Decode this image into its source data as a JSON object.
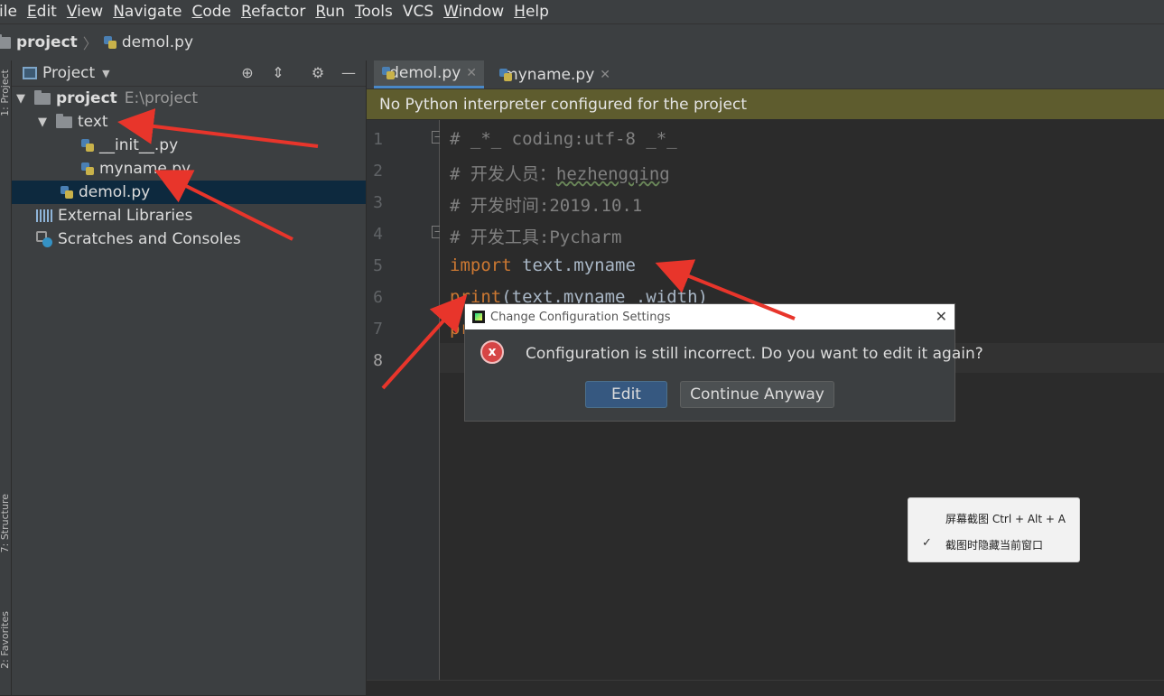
{
  "menu": [
    {
      "label": "File",
      "display": "ile",
      "u": "",
      "rest": "ile"
    },
    {
      "label": "Edit",
      "u": "E",
      "rest": "dit"
    },
    {
      "label": "View",
      "u": "V",
      "rest": "iew"
    },
    {
      "label": "Navigate",
      "u": "N",
      "rest": "avigate"
    },
    {
      "label": "Code",
      "u": "C",
      "rest": "ode"
    },
    {
      "label": "Refactor",
      "u": "R",
      "rest": "efactor"
    },
    {
      "label": "Run",
      "u": "R",
      "rest": "un"
    },
    {
      "label": "Tools",
      "u": "T",
      "rest": "ools"
    },
    {
      "label": "VCS",
      "u": "",
      "rest": "VCS"
    },
    {
      "label": "Window",
      "u": "W",
      "rest": "indow"
    },
    {
      "label": "Help",
      "u": "H",
      "rest": "elp"
    }
  ],
  "breadcrumb": {
    "project": "project",
    "file": "demol.py"
  },
  "left_strip": {
    "project_label": "1: Project",
    "structure_label": "7: Structure",
    "favorites_label": "2: Favorites"
  },
  "project_panel": {
    "title": "Project",
    "tree": [
      {
        "label": "project",
        "path": "E:\\project"
      },
      {
        "label": "text"
      },
      {
        "label": "__init__.py"
      },
      {
        "label": "myname.py"
      },
      {
        "label": "demol.py"
      },
      {
        "label": "External Libraries"
      },
      {
        "label": "Scratches and Consoles"
      }
    ]
  },
  "editor": {
    "tabs": [
      {
        "label": "demol.py"
      },
      {
        "label": "myname.py"
      }
    ],
    "banner": "No Python interpreter configured for the project",
    "line_numbers": [
      "1",
      "2",
      "3",
      "4",
      "5",
      "6",
      "7",
      "8"
    ],
    "lines": {
      "l1": "# _*_ coding:utf-8 _*_",
      "l2_pre": "# 开发人员：",
      "l2_name": "hezhengqing",
      "l3": "# 开发时间:2019.10.1",
      "l4": "# 开发工具:Pycharm",
      "l5_kw": "import",
      "l5_rest": " text.myname",
      "l6_fn": "print",
      "l6_rest": "(text.myname .width)",
      "l7": "pr"
    }
  },
  "dialog": {
    "title": "Change Configuration Settings",
    "message": "Configuration is still incorrect. Do you want to edit it again?",
    "edit_label": "Edit",
    "continue_label": "Continue Anyway",
    "close_glyph": "✕"
  },
  "context_menu": {
    "items": [
      {
        "label": "屏幕截图 Ctrl + Alt + A",
        "checked": false
      },
      {
        "label": "截图时隐藏当前窗口",
        "checked": true
      }
    ]
  },
  "colors": {
    "accent": "#4a88c7",
    "banner": "#5e5c2e",
    "arrow": "#e8352b",
    "selection": "#0d293e"
  }
}
